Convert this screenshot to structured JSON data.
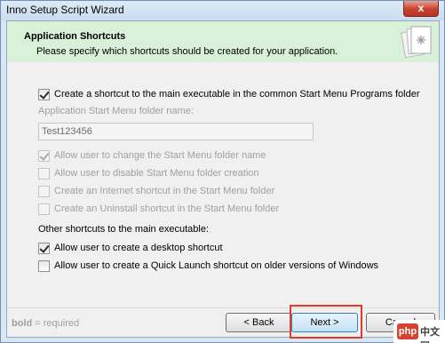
{
  "window": {
    "title": "Inno Setup Script Wizard",
    "close": "x"
  },
  "header": {
    "title": "Application Shortcuts",
    "subtitle": "Please specify which shortcuts should be created for your application.",
    "icon": "shortcuts-page-icon"
  },
  "options": [
    {
      "label": "Create a shortcut to the main executable in the common Start Menu Programs folder",
      "checked": true,
      "disabled": false
    },
    {
      "label": "Allow user to change the Start Menu folder name",
      "checked": true,
      "disabled": true
    },
    {
      "label": "Allow user to disable Start Menu folder creation",
      "checked": false,
      "disabled": true
    },
    {
      "label": "Create an Internet shortcut in the Start Menu folder",
      "checked": false,
      "disabled": true
    },
    {
      "label": "Create an Uninstall shortcut in the Start Menu folder",
      "checked": false,
      "disabled": true
    }
  ],
  "start_menu": {
    "label": "Application Start Menu folder name:",
    "value": "Test123456"
  },
  "other_shortcuts": {
    "label": "Other shortcuts to the main executable:",
    "items": [
      {
        "label": "Allow user to create a desktop shortcut",
        "checked": true
      },
      {
        "label": "Allow user to create a Quick Launch shortcut on older versions of Windows",
        "checked": false
      }
    ]
  },
  "footer": {
    "note_bold": "bold",
    "note_rest": " = required",
    "back": "< Back",
    "next": "Next >",
    "cancel": "Cancel"
  },
  "watermark": {
    "logo": "php",
    "text": "中文网"
  },
  "colors": {
    "header_bg": "#d9f0d9",
    "highlight": "#e23b2c",
    "next_btn": "#c4e1f6"
  }
}
